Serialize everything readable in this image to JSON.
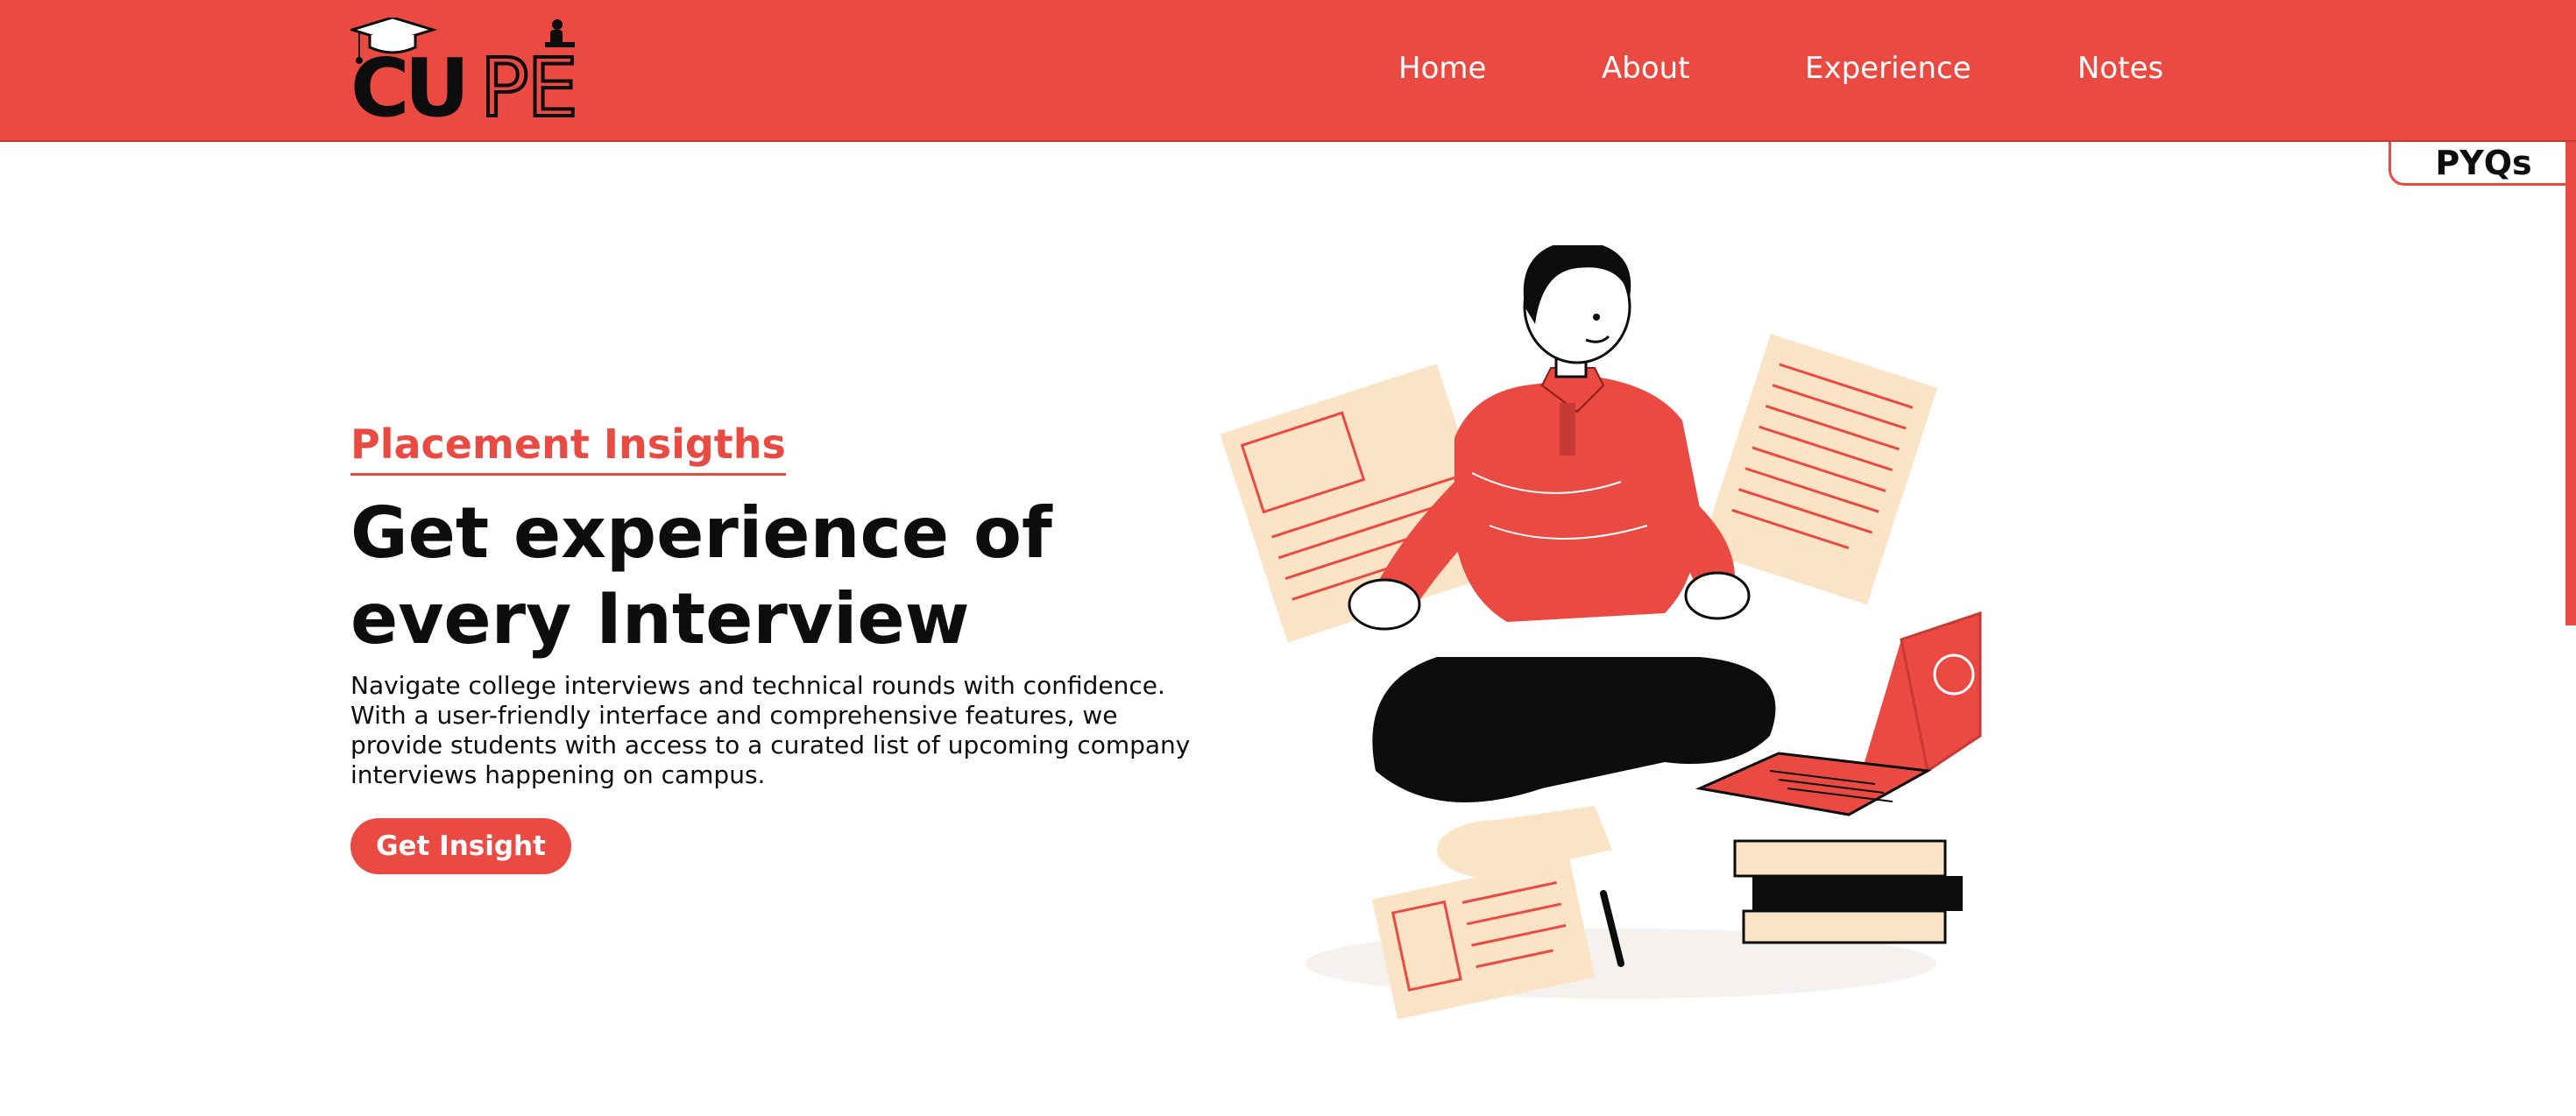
{
  "brand": {
    "name": "CUPE",
    "icon": "graduation-cap-icon"
  },
  "nav": {
    "items": [
      {
        "label": "Home"
      },
      {
        "label": "About"
      },
      {
        "label": "Experience"
      },
      {
        "label": "Notes"
      }
    ],
    "side_tab": "PYQs"
  },
  "hero": {
    "kicker": "Placement Insigths",
    "headline_line1": "Get experience of",
    "headline_line2": "every Interview",
    "description": "Navigate college interviews and technical rounds with confidence. With a user-friendly interface and comprehensive features, we provide students with access to a curated list of upcoming company interviews happening on campus.",
    "cta_label": "Get Insight"
  },
  "colors": {
    "accent": "#ea4a42",
    "text": "#0d0d0d",
    "paper": "#fbe3c6"
  }
}
